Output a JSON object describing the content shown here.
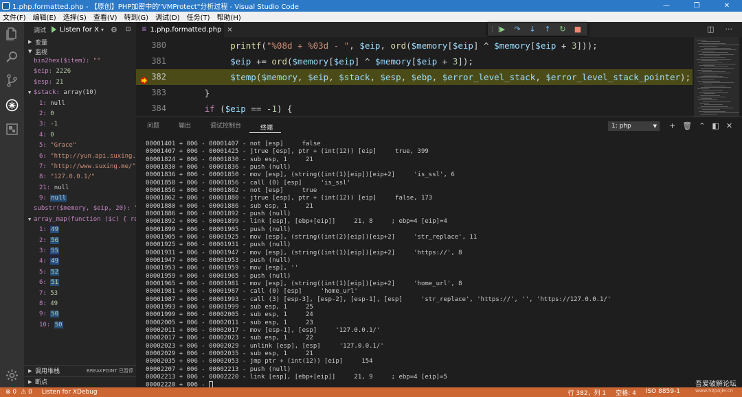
{
  "window": {
    "title": "1.php.formatted.php - 【原创】PHP加密中的\"VMProtect\"分析过程 - Visual Studio Code",
    "minimize": "—",
    "maximize": "❐",
    "close": "✕"
  },
  "menu": [
    "文件(F)",
    "编辑(E)",
    "选择(S)",
    "查看(V)",
    "转到(G)",
    "调试(D)",
    "任务(T)",
    "帮助(H)"
  ],
  "debug_toolbar": {
    "label": "调试",
    "config": "Listen for X",
    "gear": "⚙",
    "terminal": "⊡"
  },
  "sidebar": {
    "sections": {
      "variables": "变量",
      "watch": "监视",
      "callstack": "调用堆栈",
      "breakpoints": "断点",
      "breakpoint_badge": "BREAKPOINT 已暂停"
    },
    "watch": [
      {
        "name": "bin2hex($item):",
        "value": "\"\"",
        "kind": "str",
        "indent": 0
      },
      {
        "name": "$eip:",
        "value": "2226",
        "kind": "num",
        "indent": 0
      },
      {
        "name": "$esp:",
        "value": "21",
        "kind": "num",
        "indent": 0
      },
      {
        "name": "$stack:",
        "value": "array(10)",
        "kind": "kw",
        "indent": 0,
        "expanded": true
      },
      {
        "name": "1:",
        "value": "null",
        "kind": "kw",
        "indent": 1
      },
      {
        "name": "2:",
        "value": "0",
        "kind": "num",
        "indent": 1
      },
      {
        "name": "3:",
        "value": "-1",
        "kind": "num",
        "indent": 1
      },
      {
        "name": "4:",
        "value": "0",
        "kind": "num",
        "indent": 1
      },
      {
        "name": "5:",
        "value": "\"Grace\"",
        "kind": "str",
        "indent": 1
      },
      {
        "name": "6:",
        "value": "\"http://yun.api.suxing.m…",
        "kind": "str",
        "indent": 1
      },
      {
        "name": "7:",
        "value": "\"http://www.suxing.me/\"",
        "kind": "str",
        "indent": 1
      },
      {
        "name": "8:",
        "value": "\"127.0.0.1/\"",
        "kind": "str",
        "indent": 1
      },
      {
        "name": "21:",
        "value": "null",
        "kind": "kw",
        "indent": 1
      },
      {
        "name": "9:",
        "value": "null",
        "kind": "kw",
        "indent": 1,
        "highlight": true
      },
      {
        "name": "substr($memory, $eip, 20):",
        "value": "\"…",
        "kind": "str",
        "indent": 0
      },
      {
        "name": "array_map(function ($c) { ret…",
        "value": "",
        "kind": "kw",
        "indent": 0,
        "expanded": true
      },
      {
        "name": "1:",
        "value": "49",
        "kind": "num",
        "indent": 1,
        "highlight": true
      },
      {
        "name": "2:",
        "value": "56",
        "kind": "num",
        "indent": 1,
        "highlight": true
      },
      {
        "name": "3:",
        "value": "55",
        "kind": "num",
        "indent": 1,
        "highlight": true
      },
      {
        "name": "4:",
        "value": "49",
        "kind": "num",
        "indent": 1,
        "highlight": true
      },
      {
        "name": "5:",
        "value": "52",
        "kind": "num",
        "indent": 1,
        "highlight": true
      },
      {
        "name": "6:",
        "value": "51",
        "kind": "num",
        "indent": 1,
        "highlight": true
      },
      {
        "name": "7:",
        "value": "53",
        "kind": "num",
        "indent": 1
      },
      {
        "name": "8:",
        "value": "49",
        "kind": "num",
        "indent": 1
      },
      {
        "name": "9:",
        "value": "50",
        "kind": "num",
        "indent": 1,
        "highlight": true
      },
      {
        "name": "10:",
        "value": "50",
        "kind": "num",
        "indent": 1,
        "highlight": true
      }
    ]
  },
  "tab": {
    "label": "1.php.formatted.php",
    "icon": "php",
    "close": "×"
  },
  "editor": {
    "lines": [
      {
        "no": "380",
        "tokens": [
          [
            "fn",
            "printf"
          ],
          [
            "pn",
            "("
          ],
          [
            "str",
            "\"%08d + %03d - \""
          ],
          [
            "pn",
            ", "
          ],
          [
            "var",
            "$eip"
          ],
          [
            "pn",
            ", "
          ],
          [
            "fn",
            "ord"
          ],
          [
            "pn",
            "("
          ],
          [
            "var",
            "$memory"
          ],
          [
            "pn",
            "["
          ],
          [
            "var",
            "$eip"
          ],
          [
            "pn",
            "] ^ "
          ],
          [
            "var",
            "$memory"
          ],
          [
            "pn",
            "["
          ],
          [
            "var",
            "$eip"
          ],
          [
            "pn",
            " + "
          ],
          [
            "num",
            "3"
          ],
          [
            "pn",
            "]));"
          ]
        ],
        "indent": 4
      },
      {
        "no": "381",
        "tokens": [
          [
            "var",
            "$eip"
          ],
          [
            "pn",
            " += "
          ],
          [
            "fn",
            "ord"
          ],
          [
            "pn",
            "("
          ],
          [
            "var",
            "$memory"
          ],
          [
            "pn",
            "["
          ],
          [
            "var",
            "$eip"
          ],
          [
            "pn",
            "] ^ "
          ],
          [
            "var",
            "$memory"
          ],
          [
            "pn",
            "["
          ],
          [
            "var",
            "$eip"
          ],
          [
            "pn",
            " + "
          ],
          [
            "num",
            "3"
          ],
          [
            "pn",
            "]);"
          ]
        ],
        "indent": 4
      },
      {
        "no": "382",
        "current": true,
        "tokens": [
          [
            "var",
            "$temp"
          ],
          [
            "pn",
            "("
          ],
          [
            "var",
            "$memory"
          ],
          [
            "pn",
            ", "
          ],
          [
            "var",
            "$eip"
          ],
          [
            "pn",
            ", "
          ],
          [
            "var",
            "$stack"
          ],
          [
            "pn",
            ", "
          ],
          [
            "var",
            "$esp"
          ],
          [
            "pn",
            ", "
          ],
          [
            "var",
            "$ebp"
          ],
          [
            "pn",
            ", "
          ],
          [
            "var",
            "$error_level_stack"
          ],
          [
            "pn",
            ", "
          ],
          [
            "var",
            "$error_level_stack_pointer"
          ],
          [
            "pn",
            ");"
          ]
        ],
        "indent": 4
      },
      {
        "no": "383",
        "tokens": [
          [
            "pn",
            "}"
          ]
        ],
        "indent": 2
      },
      {
        "no": "384",
        "tokens": [
          [
            "kw",
            "if"
          ],
          [
            "pn",
            " ("
          ],
          [
            "var",
            "$eip"
          ],
          [
            "pn",
            " == -"
          ],
          [
            "num",
            "1"
          ],
          [
            "pn",
            ") {"
          ]
        ],
        "indent": 2
      }
    ]
  },
  "panel": {
    "tabs": [
      "问题",
      "输出",
      "调试控制台",
      "终端"
    ],
    "active_tab": 3,
    "terminal_select": "1: php",
    "lines": [
      "00001401 + 006 - 00001407 - not [esp]     false",
      "00001407 + 006 - 00001425 - jtrue [esp], ptr + (int(12)) [eip]     true, 399",
      "00001824 + 006 - 00001830 - sub esp, 1     21",
      "00001830 + 006 - 00001836 - push (null)",
      "00001836 + 006 - 00001850 - mov [esp], (string((int(1)[eip])[eip+2]     'is_ssl', 6",
      "00001850 + 006 - 00001856 - call (0) [esp]     'is_ssl'",
      "00001856 + 006 - 00001862 - not [esp]     true",
      "00001862 + 006 - 00001880 - jtrue [esp], ptr + (int(12)) [eip]     false, 173",
      "00001880 + 006 - 00001886 - sub esp, 1     21",
      "00001886 + 006 - 00001892 - push (null)",
      "00001892 + 006 - 00001899 - link [esp], [ebp+[eip]]     21, 8     ; ebp=4 [eip]=4",
      "00001899 + 006 - 00001905 - push (null)",
      "00001905 + 006 - 00001925 - mov [esp], (string((int(2)[eip])[eip+2]     'str_replace', 11",
      "00001925 + 006 - 00001931 - push (null)",
      "00001931 + 006 - 00001947 - mov [esp], (string((int(1)[eip])[eip+2]     'https://', 8",
      "00001947 + 006 - 00001953 - push (null)",
      "00001953 + 006 - 00001959 - mov [esp], ''",
      "00001959 + 006 - 00001965 - push (null)",
      "00001965 + 006 - 00001981 - mov [esp], (string((int(1)[eip])[eip+2]     'home_url', 8",
      "00001981 + 006 - 00001987 - call (0) [esp]     'home_url'",
      "00001987 + 006 - 00001993 - call (3) [esp-3], [esp-2], [esp-1], [esp]     'str_replace', 'https://', '', 'https://127.0.0.1/'",
      "00001993 + 006 - 00001999 - sub esp, 1     25",
      "00001999 + 006 - 00002005 - sub esp, 1     24",
      "00002005 + 006 - 00002011 - sub esp, 1     23",
      "00002011 + 006 - 00002017 - mov [esp-1], [esp]     '127.0.0.1/'",
      "00002017 + 006 - 00002023 - sub esp, 1     22",
      "00002023 + 006 - 00002029 - unlink [esp], [esp]     '127.0.0.1/'",
      "00002029 + 006 - 00002035 - sub esp, 1     21",
      "00002035 + 006 - 00002053 - jmp ptr + (int(12)) [eip]     154",
      "00002207 + 006 - 00002213 - push (null)",
      "00002213 + 006 - 00002220 - link [esp], [ebp+[eip]]     21, 9     ; ebp=4 [eip]=5",
      "00002220 + 006 - "
    ]
  },
  "status": {
    "errors": "⊗ 0",
    "warnings": "⚠ 0",
    "debug": "Listen for XDebug",
    "position": "行 382，列 1",
    "spaces": "空格: 4",
    "encoding": "ISO 8859-1"
  },
  "watermark": {
    "line1": "吾爱破解论坛",
    "line2": "www.52pojie.cn"
  },
  "colors": {
    "statusbar": "#cc6633",
    "titlebar": "#2b79c7",
    "current_line": "#4b4b18"
  }
}
